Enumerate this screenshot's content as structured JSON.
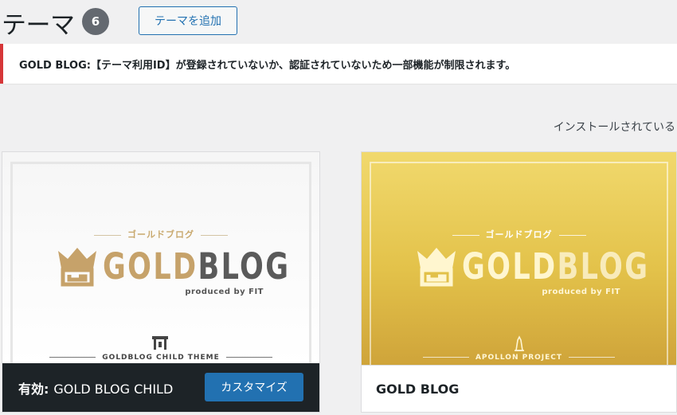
{
  "header": {
    "title": "テーマ",
    "count": "6",
    "add_button": "テーマを追加"
  },
  "notice": {
    "text": "GOLD BLOG:【テーマ利用ID】が登録されていないか、認証されていないため一部機能が制限されます。"
  },
  "installed_label": "インストールされている",
  "themes": [
    {
      "sub_label": "ゴールドブログ",
      "logo_part1": "GOLD",
      "logo_part2": "BLOG",
      "produced_by": "produced by FIT",
      "footer_label": "GOLDBLOG CHILD THEME",
      "active_prefix": "有効:",
      "name": "GOLD BLOG CHILD",
      "customize_button": "カスタマイズ"
    },
    {
      "sub_label": "ゴールドブログ",
      "logo_part1": "GOLD",
      "logo_part2": "BLOG",
      "produced_by": "produced by FIT",
      "footer_label": "APOLLON PROJECT",
      "name": "GOLD BLOG"
    }
  ],
  "colors": {
    "accent": "#2271b1",
    "error_border": "#d63638",
    "dark_bar": "#1d2327",
    "gold": "#c6a26a"
  }
}
